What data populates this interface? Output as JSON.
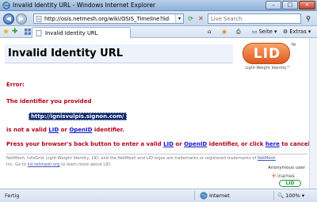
{
  "window": {
    "title": "Invalid Identity URL - Windows Internet Explorer",
    "minimize": "–",
    "maximize": "□",
    "close": "×"
  },
  "address": {
    "url": "http://osis.netmesh.org/wiki/OSIS_Timeline?lid=ignisvulpis.s",
    "search_placeholder": "Live Search"
  },
  "tab": {
    "label": "Invalid Identity URL"
  },
  "commands": {
    "page": "Seite",
    "tools": "Extras"
  },
  "page": {
    "heading": "Invalid Identity URL",
    "logo_text": "LID",
    "logo_tm": "TM",
    "logo_subtitle": "Light-Weight Identity™",
    "error_label": "Error:",
    "provided_text": "The identifier you provided",
    "identifier": "http://ignisvulpis.signon.com/",
    "notvalid_prefix": "is not a valid",
    "lid_link": "LID",
    "or_text": "or",
    "openid_link": "OpenID",
    "identifier_word": "identifier.",
    "back_text": "Press your browser's back button to enter a valid",
    "back_or": "or",
    "back_identifier": "identifier, or click",
    "here_link": "here",
    "back_end": "to cancel.",
    "footer_line1_a": "NetMesh, InfoGrid, Light-Weight Identity, LID, and the NetMesh and LID logos are trademarks or registered trademarks of",
    "footer_netmesh_link": "NetMesh",
    "footer_line2_a": "Inc. Go to",
    "footer_lid_link": "lid.netmesh.org",
    "footer_line2_b": "to learn more about LID.",
    "anonymous_user": "Anonymous user",
    "inames_text": "inames",
    "mini_lid": "LID"
  },
  "status": {
    "text": "Fertig",
    "zone": "Internet",
    "zoom": "100%"
  }
}
